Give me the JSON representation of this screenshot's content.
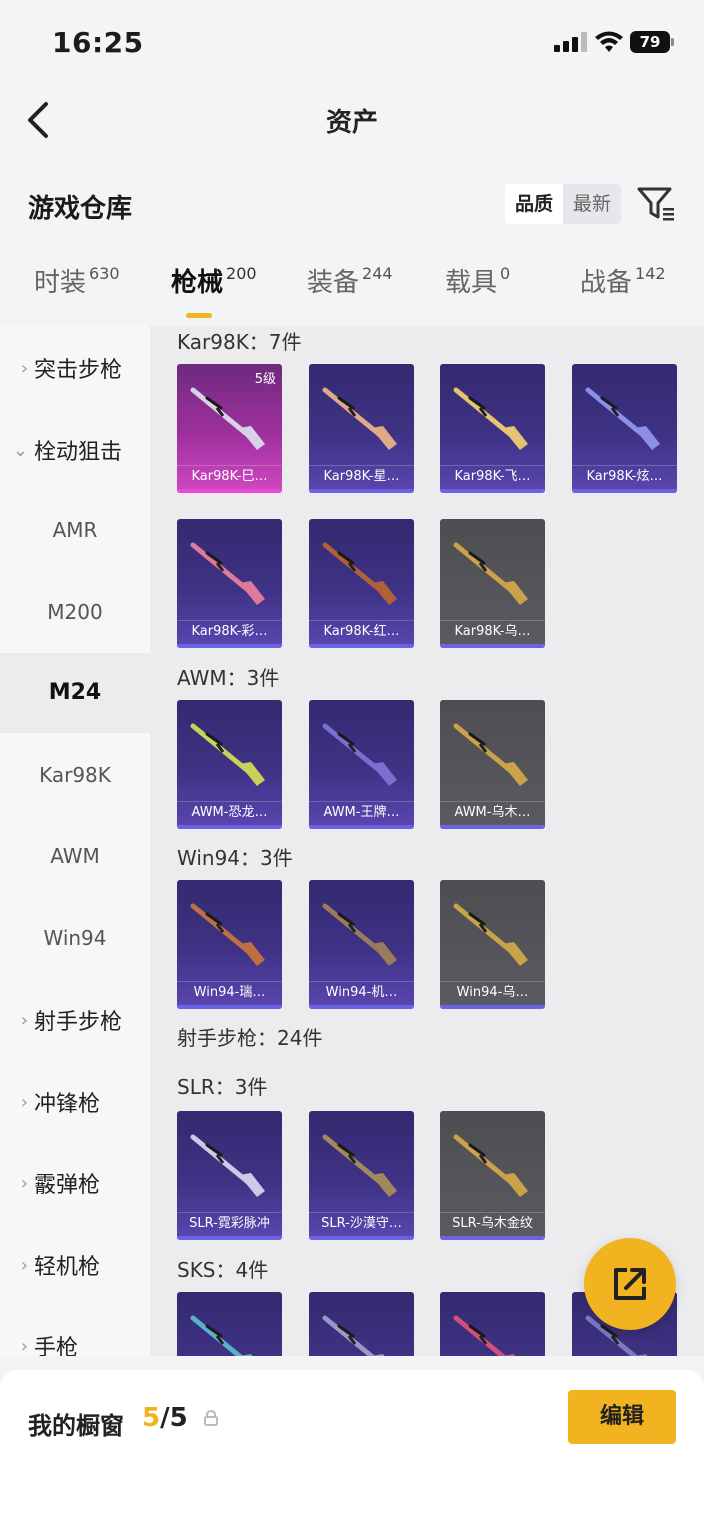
{
  "status": {
    "time": "16:25",
    "battery": "79"
  },
  "nav": {
    "title": "资产"
  },
  "repo": {
    "title": "游戏仓库",
    "sort_quality": "品质",
    "sort_latest": "最新"
  },
  "tabs": [
    {
      "label": "时装",
      "count": "630"
    },
    {
      "label": "枪械",
      "count": "200"
    },
    {
      "label": "装备",
      "count": "244"
    },
    {
      "label": "载具",
      "count": "0"
    },
    {
      "label": "战备",
      "count": "142"
    }
  ],
  "sidebar": {
    "cats": [
      "突击步枪",
      "栓动狙击",
      "射手步枪",
      "冲锋枪",
      "霰弹枪",
      "轻机枪",
      "手枪"
    ],
    "subs": [
      "AMR",
      "M200",
      "M24",
      "Kar98K",
      "AWM",
      "Win94"
    ]
  },
  "sections": {
    "kar98k": "Kar98K：7件",
    "awm": "AWM：3件",
    "win94": "Win94：3件",
    "marksman": "射手步枪：24件",
    "slr": "SLR：3件",
    "sks": "SKS：4件"
  },
  "items": {
    "kar98k": [
      {
        "name": "Kar98K-巳…",
        "level": "5级",
        "rarity": "pink",
        "color": "#d8d2e8"
      },
      {
        "name": "Kar98K-星…",
        "rarity": "purple",
        "color": "#e0a98a"
      },
      {
        "name": "Kar98K-飞…",
        "rarity": "purple",
        "color": "#e6c370"
      },
      {
        "name": "Kar98K-炫…",
        "rarity": "purple",
        "color": "#8c8fe8"
      },
      {
        "name": "Kar98K-彩…",
        "rarity": "purple",
        "color": "#e07a9a"
      },
      {
        "name": "Kar98K-红…",
        "rarity": "purple",
        "color": "#b0603a"
      },
      {
        "name": "Kar98K-乌…",
        "rarity": "grey",
        "color": "#c9a24a"
      }
    ],
    "awm": [
      {
        "name": "AWM-恐龙…",
        "rarity": "purple",
        "color": "#c8d25a"
      },
      {
        "name": "AWM-王牌…",
        "rarity": "purple",
        "color": "#7a6fd0"
      },
      {
        "name": "AWM-乌木…",
        "rarity": "grey",
        "color": "#c9a24a"
      }
    ],
    "win94": [
      {
        "name": "Win94-瑞…",
        "rarity": "purple",
        "color": "#c07040"
      },
      {
        "name": "Win94-机…",
        "rarity": "purple",
        "color": "#9a7b5a"
      },
      {
        "name": "Win94-乌…",
        "rarity": "grey",
        "color": "#c9a24a"
      }
    ],
    "slr": [
      {
        "name": "SLR-霓彩脉冲",
        "rarity": "purple",
        "color": "#d0c8e8"
      },
      {
        "name": "SLR-沙漠守…",
        "rarity": "purple",
        "color": "#a08a5a"
      },
      {
        "name": "SLR-乌木金纹",
        "rarity": "grey",
        "color": "#c9a24a"
      }
    ],
    "sks": [
      {
        "name": "",
        "rarity": "purple",
        "color": "#5ab0c8"
      },
      {
        "name": "",
        "rarity": "purple",
        "color": "#9a96c8"
      },
      {
        "name": "",
        "rarity": "purple",
        "color": "#d0507a"
      },
      {
        "name": "",
        "rarity": "purple",
        "color": "#7a7ac0"
      }
    ]
  },
  "bottom": {
    "label": "我的橱窗",
    "current": "5",
    "total": "/5",
    "edit": "编辑"
  },
  "colors": {
    "accent": "#f2b320"
  }
}
